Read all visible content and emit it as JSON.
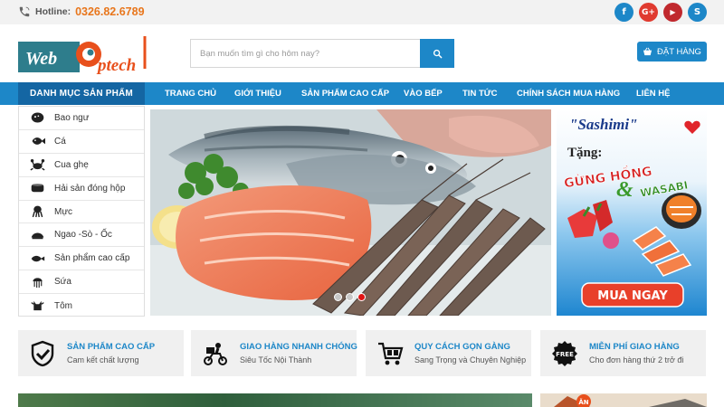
{
  "topbar": {
    "hotline_label": "Hotline:",
    "hotline_number": "0326.82.6789",
    "socials": [
      {
        "name": "facebook",
        "glyph": "f",
        "color": "#1d87c8"
      },
      {
        "name": "google-plus",
        "glyph": "G+",
        "color": "#e03a2f"
      },
      {
        "name": "youtube",
        "glyph": "▶",
        "color": "#c0282d"
      },
      {
        "name": "skype",
        "glyph": "S",
        "color": "#1d87c8"
      }
    ]
  },
  "header": {
    "logo_text_a": "Web",
    "logo_text_b": "ptech",
    "search_placeholder": "Bạn muốn tìm gì cho hôm nay?",
    "order_label": "ĐẶT HÀNG"
  },
  "nav": {
    "category_title": "DANH MỤC SẢN PHẨM",
    "items": [
      "TRANG CHỦ",
      "GIỚI THIỆU",
      "SẢN PHẨM CAO CẤP",
      "VÀO BẾP",
      "TIN TỨC",
      "CHÍNH SÁCH MUA HÀNG",
      "LIÊN HỆ"
    ]
  },
  "sidebar": {
    "items": [
      {
        "label": "Bao ngư",
        "icon": "abalone-icon"
      },
      {
        "label": "Cá",
        "icon": "fish-icon"
      },
      {
        "label": "Cua ghẹ",
        "icon": "crab-icon"
      },
      {
        "label": "Hải sản đóng hộp",
        "icon": "can-icon"
      },
      {
        "label": "Mực",
        "icon": "squid-icon"
      },
      {
        "label": "Ngao -Sò - Ốc",
        "icon": "clam-icon"
      },
      {
        "label": "Sản phẩm cao cấp",
        "icon": "premium-fish-icon"
      },
      {
        "label": "Sứa",
        "icon": "jellyfish-icon"
      },
      {
        "label": "Tôm",
        "icon": "shrimp-icon"
      }
    ]
  },
  "slider": {
    "dot_count": 3,
    "active_dot": 3
  },
  "promo": {
    "title": "\"Sashimi\"",
    "tang": "Tặng:",
    "line1": "GỪNG HỒNG",
    "amp": "&",
    "line2": "WASABI",
    "cta": "MUA NGAY"
  },
  "features": [
    {
      "title": "SẢN PHẨM CAO CẤP",
      "subtitle": "Cam kết chất lượng",
      "icon": "shield-check-icon"
    },
    {
      "title": "GIAO HÀNG NHANH CHÓNG",
      "subtitle": "Siêu Tốc Nội Thành",
      "icon": "delivery-motorbike-icon"
    },
    {
      "title": "QUY CÁCH GỌN GÀNG",
      "subtitle": "Sang Trọng và Chuyên Nghiệp",
      "icon": "cart-icon"
    },
    {
      "title": "MIỄN PHÍ GIAO HÀNG",
      "subtitle": "Cho đơn hàng thứ 2 trở đi",
      "icon": "free-badge-icon",
      "badge": "FREE"
    }
  ],
  "bottom": {
    "badge": "ĂN"
  },
  "colors": {
    "brand_blue": "#1d87c8",
    "nav_dark": "#1466a3",
    "hotline_orange": "#e8761c",
    "logo_teal": "#2e7d8c",
    "logo_orange": "#e8501c"
  }
}
